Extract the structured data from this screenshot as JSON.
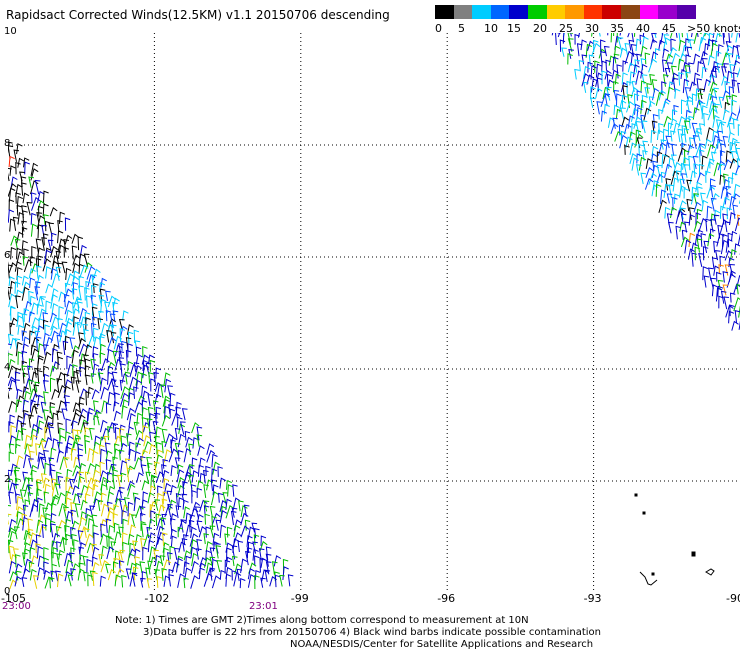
{
  "title": "Rapidsact Corrected Winds(12.5KM) v1.1 20150706 descending",
  "scale": {
    "labels": [
      "0",
      "5",
      "10",
      "15",
      "20",
      "25",
      "30",
      "35",
      "40",
      "45",
      ">50 knots"
    ],
    "colors": [
      "#000000",
      "#808080",
      "#00ccff",
      "#0066ff",
      "#0000cc",
      "#00cc00",
      "#ffcc00",
      "#ff9900",
      "#ff3300",
      "#cc0000",
      "#8b4513",
      "#ff00ff",
      "#9900cc",
      "#5500aa"
    ]
  },
  "map": {
    "y_ticks": [
      "10",
      "8",
      "6",
      "4",
      "2",
      "0"
    ],
    "x_ticks": [
      "-105",
      "-102",
      "-99",
      "-96",
      "-93",
      "-90"
    ],
    "times": [
      "23:00",
      "23:01"
    ]
  },
  "notes": {
    "line1": "Note: 1) Times are GMT 2)Times along bottom correspond to measurement at 10N",
    "line2": "3)Data buffer is 22 hrs from 20150706 4) Black wind barbs indicate possible contamination",
    "line3": "NOAA/NESDIS/Center for Satellite Applications and Research"
  }
}
